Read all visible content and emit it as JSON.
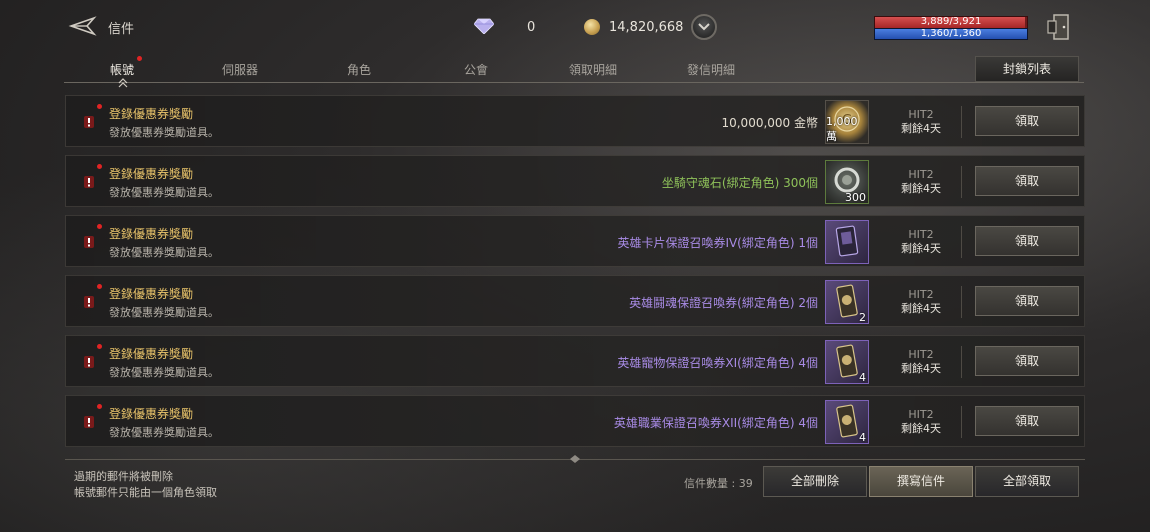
{
  "header": {
    "title": "信件",
    "gem_count": "0",
    "gold_count": "14,820,668",
    "hp_text": "3,889/3,921",
    "hp_ratio": 0.99,
    "mp_text": "1,360/1,360",
    "mp_ratio": 1.0
  },
  "tabs": [
    {
      "label": "帳號",
      "active": true,
      "has_dot": true
    },
    {
      "label": "伺服器",
      "active": false
    },
    {
      "label": "角色",
      "active": false
    },
    {
      "label": "公會",
      "active": false
    },
    {
      "label": "領取明細",
      "active": false
    },
    {
      "label": "發信明細",
      "active": false
    }
  ],
  "block_list_label": "封鎖列表",
  "mails": [
    {
      "title": "登錄優惠券獎勵",
      "subtitle": "發放優惠券獎勵道具。",
      "item": "10,000,000 金幣",
      "item_color": "#e2dccf",
      "icon": "gold-coin-icon",
      "qty": "1,000萬",
      "sender": "HIT2",
      "remain": "剩餘4天",
      "claim": "領取"
    },
    {
      "title": "登錄優惠券獎勵",
      "subtitle": "發放優惠券獎勵道具。",
      "item": "坐騎守魂石(綁定角色) 300個",
      "item_color": "#8fc25a",
      "icon": "mount-soul-stone-icon",
      "qty": "300",
      "sender": "HIT2",
      "remain": "剩餘4天",
      "claim": "領取"
    },
    {
      "title": "登錄優惠券獎勵",
      "subtitle": "發放優惠券獎勵道具。",
      "item": "英雄卡片保證召喚券IV(綁定角色) 1個",
      "item_color": "#a98be6",
      "icon": "hero-card-ticket-icon",
      "qty": "",
      "sender": "HIT2",
      "remain": "剩餘4天",
      "claim": "領取"
    },
    {
      "title": "登錄優惠券獎勵",
      "subtitle": "發放優惠券獎勵道具。",
      "item": "英雄鬪魂保證召喚券(綁定角色) 2個",
      "item_color": "#a98be6",
      "icon": "hero-spirit-ticket-icon",
      "qty": "2",
      "sender": "HIT2",
      "remain": "剩餘4天",
      "claim": "領取"
    },
    {
      "title": "登錄優惠券獎勵",
      "subtitle": "發放優惠券獎勵道具。",
      "item": "英雄寵物保證召喚券XI(綁定角色) 4個",
      "item_color": "#a98be6",
      "icon": "hero-pet-ticket-icon",
      "qty": "4",
      "sender": "HIT2",
      "remain": "剩餘4天",
      "claim": "領取"
    },
    {
      "title": "登錄優惠券獎勵",
      "subtitle": "發放優惠券獎勵道具。",
      "item": "英雄職業保證召喚券XII(綁定角色) 4個",
      "item_color": "#a98be6",
      "icon": "hero-class-ticket-icon",
      "qty": "4",
      "sender": "HIT2",
      "remain": "剩餘4天",
      "claim": "領取"
    }
  ],
  "footer": {
    "note1": "過期的郵件將被刪除",
    "note2": "帳號郵件只能由一個角色領取",
    "mail_count": "信件數量 : 39",
    "delete_all": "全部刪除",
    "write_mail": "撰寫信件",
    "claim_all": "全部領取"
  }
}
